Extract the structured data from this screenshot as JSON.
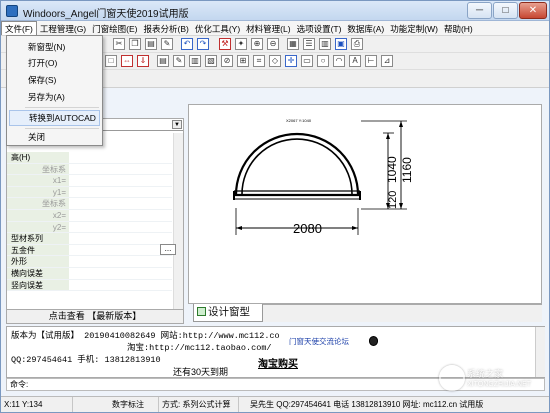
{
  "title_bar": {
    "title": "Windoors_Angel门窗天使2019试用版"
  },
  "window_controls": {
    "minimize": "─",
    "maximize": "□",
    "close": "✕"
  },
  "menus": [
    "文件(F)",
    "工程管理(G)",
    "门窗绘图(E)",
    "报表分析(B)",
    "优化工具(Y)",
    "材料管理(L)",
    "选项设置(T)",
    "数据库(A)",
    "功能定制(W)",
    "帮助(H)"
  ],
  "file_menu": {
    "items": [
      "新窗型(N)",
      "打开(O)",
      "保存(S)",
      "另存为(A)",
      "转换到AUTOCAD",
      "关闭"
    ],
    "highlighted": "转换到AUTOCAD"
  },
  "toolbar_icons": {
    "row1": [
      "cut-icon",
      "copy-icon",
      "paste-icon",
      "pencil-icon",
      "undo-icon",
      "redo-icon",
      "tools-icon",
      "magic-icon",
      "zoom-in-icon",
      "zoom-out-icon",
      "grid-icon",
      "list-icon",
      "table-icon",
      "save-icon",
      "print-icon"
    ],
    "row2": [
      "frame-icon",
      "line-tool-icon",
      "arrow-down-icon",
      "panel-icon",
      "sash-icon",
      "mullion-icon",
      "transom-icon",
      "pen-icon",
      "grid-tool-icon",
      "fill-icon",
      "glass-icon",
      "move-icon",
      "rect-icon",
      "circle-icon",
      "arc-icon",
      "text-icon",
      "dim-icon",
      "measure-icon"
    ],
    "row2_text": [
      "A"
    ]
  },
  "property_panel": {
    "rows": [
      {
        "name": "高(H)",
        "kind": "cat"
      },
      {
        "name": "坐标系",
        "kind": "sub"
      },
      {
        "name": "x1=",
        "kind": "sub"
      },
      {
        "name": "y1=",
        "kind": "sub"
      },
      {
        "name": "坐标系",
        "kind": "sub"
      },
      {
        "name": "x2=",
        "kind": "sub"
      },
      {
        "name": "y2=",
        "kind": "sub"
      },
      {
        "name": "型材系列",
        "kind": "cat"
      },
      {
        "name": "五金件",
        "kind": "cat"
      },
      {
        "name": "外形",
        "kind": "cat"
      },
      {
        "name": "横向误差",
        "kind": "cat"
      },
      {
        "name": "竖向误差",
        "kind": "cat"
      }
    ],
    "footer": "点击查看 【最新版本】",
    "scroll_button": "..."
  },
  "drawing": {
    "title_label": "X2067 Y:1040",
    "width_dim": "2080",
    "height_dim_outer": "1160",
    "height_dim_inner": "1040",
    "height_dim_small": "120"
  },
  "design_tab": {
    "label": "设计窗型"
  },
  "info": {
    "line1": "版本为【试用版】 20190410082649  网站:http://www.mc112.co",
    "link": "门窗天使交流论坛",
    "line2": "淘宝:http://mc112.taobao.com/",
    "line3": "QQ:297454641 手机: 13812813910",
    "buy": "淘宝购买",
    "trial": "还有30天到期"
  },
  "command": {
    "label": "命令:"
  },
  "status": {
    "coords": "X:11  Y:134",
    "mode": "数字标注",
    "method": "方式: 系列公式计算",
    "contact": "吴先生 QQ:297454641 电话 13812813910 网址: mc112.cn 试用版"
  },
  "watermark": {
    "text": "系统之家",
    "url": "XITONGZHIJIA.NET"
  },
  "colors": {
    "accent": "#2e6fbf",
    "highlight": "#e6effb",
    "panel": "#e9f0e4"
  }
}
